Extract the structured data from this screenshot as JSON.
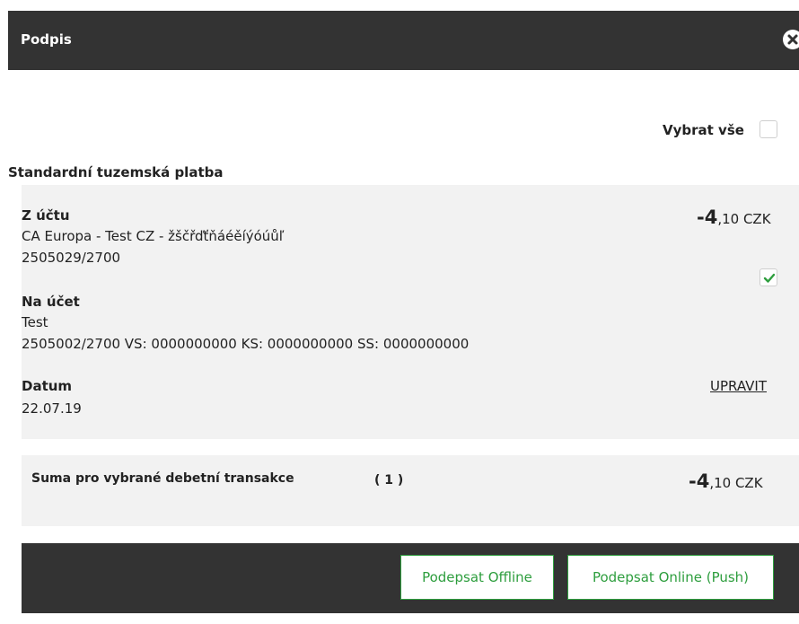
{
  "dialog": {
    "title": "Podpis"
  },
  "select_all": {
    "label": "Vybrat vše"
  },
  "group": {
    "title": "Standardní tuzemská platba"
  },
  "transaction": {
    "from_label": "Z účtu",
    "from_name": "CA Europa - Test CZ - žščřďťňáéěíýóúůľ",
    "from_account": "2505029/2700",
    "amount_main": "-4",
    "amount_rest": ",10 CZK",
    "to_label": "Na účet",
    "to_name": "Test",
    "to_account": "2505002/2700 VS: 0000000000 KS: 0000000000 SS: 0000000000",
    "date_label": "Datum",
    "date_value": "22.07.19",
    "edit_label": "UPRAVIT",
    "selected": true
  },
  "summary": {
    "label": "Suma pro vybrané debetní transakce",
    "count": "( 1 )",
    "amount_main": "-4",
    "amount_rest": ",10 CZK"
  },
  "buttons": {
    "offline": "Podepsat Offline",
    "online": "Podepsat Online (Push)"
  },
  "colors": {
    "header": "#333333",
    "accent": "#2e9e3e",
    "card": "#f2f2f2"
  },
  "icons": {
    "close": "close-icon",
    "check": "checkmark-icon"
  }
}
